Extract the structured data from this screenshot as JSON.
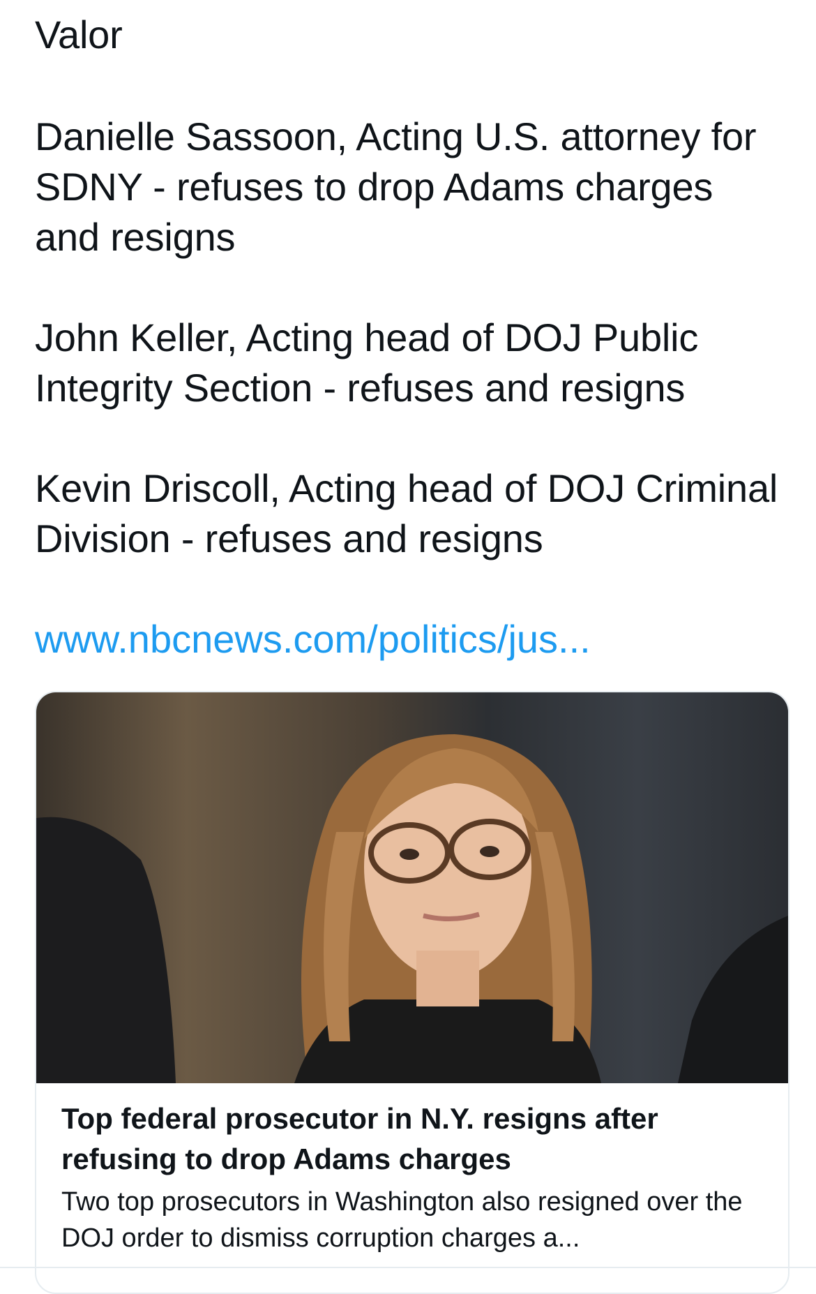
{
  "post": {
    "paragraphs": [
      "Valor",
      "Danielle Sassoon, Acting U.S. attorney for SDNY - refuses to drop Adams charges and resigns",
      "John Keller, Acting head of DOJ Public Integrity Section - refuses and resigns",
      "Kevin Driscoll, Acting head of DOJ Criminal Division - refuses and resigns"
    ],
    "link_text": "www.nbcnews.com/politics/jus..."
  },
  "link_card": {
    "title": "Top federal prosecutor in N.Y. resigns after refusing to drop Adams charges",
    "description": "Two top prosecutors in Washington also resigned over the DOJ order to dismiss corruption charges a..."
  },
  "colors": {
    "text": "#0f1419",
    "link": "#1d9bf0",
    "border": "#e6ecf0"
  }
}
